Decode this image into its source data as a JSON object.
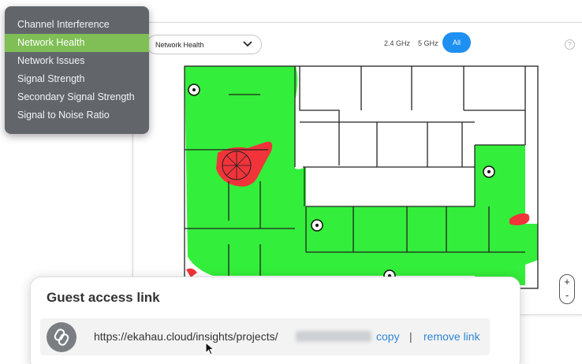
{
  "floor_view": {
    "view_select_label": "Network Health",
    "frequencies": [
      "2.4 GHz",
      "5 GHz",
      "All"
    ],
    "selected_frequency": "All",
    "help_label": "?",
    "zoom_in_label": "+",
    "zoom_out_label": "-"
  },
  "visualization_menu": {
    "items": [
      "Channel Interference",
      "Network Health",
      "Network Issues",
      "Signal Strength",
      "Secondary Signal Strength",
      "Signal to Noise Ratio"
    ],
    "selected": "Network Health"
  },
  "guest_access": {
    "title": "Guest access link",
    "url": "https://ekahau.cloud/insights/projects/",
    "copy_label": "copy",
    "separator": "|",
    "remove_label": "remove link"
  },
  "colors": {
    "healthy": "#33ee3a",
    "issue": "#f0343a",
    "accent": "#1e90f2",
    "menu_bg": "#62666b",
    "menu_selected": "#7fbf55",
    "link": "#2f86d6"
  },
  "icons": [
    "chevron-down-icon",
    "help-icon",
    "link-icon",
    "access-point-icon",
    "cursor-icon"
  ]
}
